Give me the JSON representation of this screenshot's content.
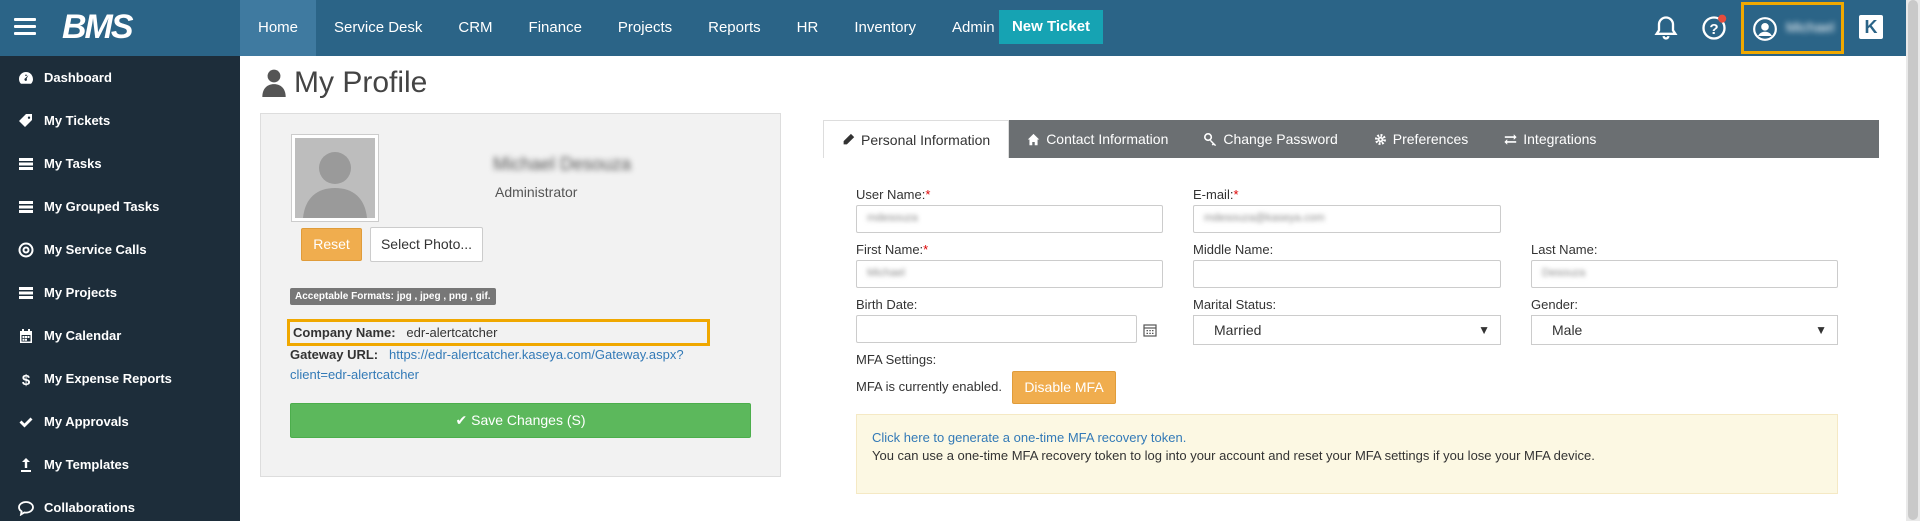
{
  "app": {
    "logo": "BMS"
  },
  "nav": {
    "items": [
      "Home",
      "Service Desk",
      "CRM",
      "Finance",
      "Projects",
      "Reports",
      "HR",
      "Inventory",
      "Admin"
    ],
    "new_ticket": "New Ticket",
    "user_name": "Michael"
  },
  "sidebar": {
    "items": [
      {
        "label": "Dashboard",
        "icon": "dashboard-icon"
      },
      {
        "label": "My Tickets",
        "icon": "ticket-icon"
      },
      {
        "label": "My Tasks",
        "icon": "tasks-icon"
      },
      {
        "label": "My Grouped Tasks",
        "icon": "grouped-tasks-icon"
      },
      {
        "label": "My Service Calls",
        "icon": "service-calls-icon"
      },
      {
        "label": "My Projects",
        "icon": "projects-icon"
      },
      {
        "label": "My Calendar",
        "icon": "calendar-icon"
      },
      {
        "label": "My Expense Reports",
        "icon": "dollar-icon"
      },
      {
        "label": "My Approvals",
        "icon": "check-icon"
      },
      {
        "label": "My Templates",
        "icon": "template-icon"
      },
      {
        "label": "Collaborations",
        "icon": "chat-icon"
      }
    ]
  },
  "page": {
    "title": "My Profile"
  },
  "profile": {
    "name": "Michael Desouza",
    "role": "Administrator",
    "reset": "Reset",
    "select_photo": "Select Photo...",
    "formats": "Acceptable Formats: jpg , jpeg , png , gif.",
    "company_label": "Company Name:",
    "company_value": "edr-alertcatcher",
    "gateway_label": "Gateway URL:",
    "gateway_value": "https://edr-alertcatcher.kaseya.com/Gateway.aspx?client=edr-alertcatcher",
    "save": "Save Changes (S)"
  },
  "tabs": [
    "Personal Information",
    "Contact Information",
    "Change Password",
    "Preferences",
    "Integrations"
  ],
  "form": {
    "user_name_label": "User Name:",
    "user_name_value": "mdesouza",
    "email_label": "E-mail:",
    "email_value": "mdesouza@kaseya.com",
    "first_name_label": "First Name:",
    "first_name_value": "Michael",
    "middle_name_label": "Middle Name:",
    "middle_name_value": "",
    "last_name_label": "Last Name:",
    "last_name_value": "Desouza",
    "birth_date_label": "Birth Date:",
    "birth_date_value": "",
    "marital_label": "Marital Status:",
    "marital_value": "Married",
    "gender_label": "Gender:",
    "gender_value": "Male",
    "mfa_label": "MFA Settings:",
    "mfa_status": "MFA is currently enabled.",
    "disable_mfa": "Disable MFA",
    "mfa_link": "Click here to generate a one-time MFA recovery token.",
    "mfa_help": "You can use a one-time MFA recovery token to log into your account and reset your MFA settings if you lose your MFA device."
  },
  "colors": {
    "topbar": "#2b6487",
    "sidebar": "#1d2d3a",
    "accent": "#f0ad4e",
    "save": "#5cb85c",
    "highlight": "#f0a800"
  }
}
